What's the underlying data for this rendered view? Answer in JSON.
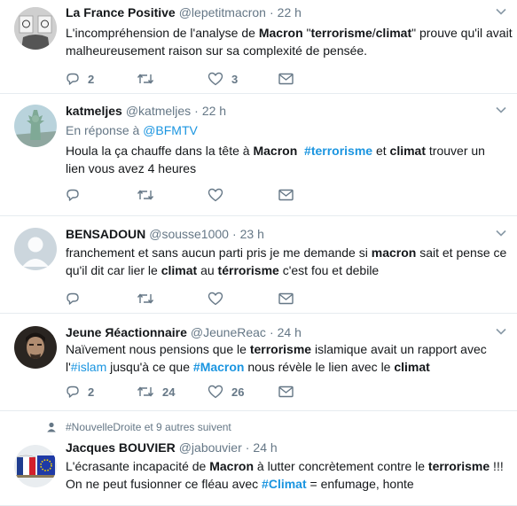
{
  "tweets": [
    {
      "name": "La France Positive",
      "handle": "@lepetitmacron",
      "time": "22 h",
      "text_lines": [
        [
          {
            "t": "L'incompréhension de l'analyse de "
          },
          {
            "t": "Macron",
            "s": "b"
          },
          {
            "t": " \""
          },
          {
            "t": "terrorisme",
            "s": "b"
          },
          {
            "t": "/"
          },
          {
            "t": "climat",
            "s": "b"
          },
          {
            "t": "\" prouve qu'il avait"
          }
        ],
        [
          {
            "t": "malheureusement raison sur sa complexité de pensée."
          }
        ]
      ],
      "replies": "2",
      "retweets": "",
      "likes": "3"
    },
    {
      "name": "katmeljes",
      "handle": "@katmeljes",
      "time": "22 h",
      "reply_prefix": "En réponse à",
      "reply_link": "@BFMTV",
      "text_lines": [
        [
          {
            "t": "Houla la ça chauffe dans la tête à "
          },
          {
            "t": "Macron",
            "s": "b"
          },
          {
            "t": "  "
          },
          {
            "t": "#terrorisme",
            "s": "tagb"
          },
          {
            "t": " et "
          },
          {
            "t": "climat",
            "s": "b"
          },
          {
            "t": " trouver un"
          }
        ],
        [
          {
            "t": "lien vous avez 4 heures"
          }
        ]
      ],
      "replies": "",
      "retweets": "",
      "likes": ""
    },
    {
      "name": "BENSADOUN",
      "handle": "@sousse1000",
      "time": "23 h",
      "text_lines": [
        [
          {
            "t": "franchement et sans aucun parti pris je me demande si "
          },
          {
            "t": "macron",
            "s": "b"
          },
          {
            "t": " sait et pense ce"
          }
        ],
        [
          {
            "t": "qu'il dit car lier le "
          },
          {
            "t": "climat",
            "s": "b"
          },
          {
            "t": " au "
          },
          {
            "t": "térrorisme",
            "s": "b"
          },
          {
            "t": " c'est fou et debile"
          }
        ]
      ],
      "replies": "",
      "retweets": "",
      "likes": ""
    },
    {
      "name": "Jeune Яéactionnaire",
      "handle": "@JeuneReac",
      "time": "24 h",
      "text_lines": [
        [
          {
            "t": "Naïvement nous pensions que le "
          },
          {
            "t": "terrorisme",
            "s": "b"
          },
          {
            "t": " islamique avait un rapport avec"
          }
        ],
        [
          {
            "t": "l'"
          },
          {
            "t": "#islam",
            "s": "tag"
          },
          {
            "t": " jusqu'à ce que "
          },
          {
            "t": "#Macron",
            "s": "tagb"
          },
          {
            "t": " nous révèle le lien avec le "
          },
          {
            "t": "climat",
            "s": "b"
          }
        ]
      ],
      "replies": "2",
      "retweets": "24",
      "likes": "26"
    },
    {
      "context": "#NouvelleDroite et 9 autres suivent",
      "name": "Jacques BOUVIER",
      "handle": "@jabouvier",
      "time": "24 h",
      "text_lines": [
        [
          {
            "t": "L'écrasante incapacité de "
          },
          {
            "t": "Macron",
            "s": "b"
          },
          {
            "t": " à lutter concrètement contre le "
          },
          {
            "t": "terrorisme",
            "s": "b"
          },
          {
            "t": " !!!"
          }
        ],
        [
          {
            "t": "On ne peut fusionner ce fléau avec "
          },
          {
            "t": "#Climat",
            "s": "tagb"
          },
          {
            "t": " = enfumage, honte"
          }
        ]
      ]
    }
  ],
  "icons": {
    "reply": "reply-icon",
    "retweet": "retweet-icon",
    "like": "heart-icon",
    "dm": "envelope-icon",
    "more": "chevron-down-icon",
    "context": "person-icon"
  },
  "colors": {
    "text": "#14171a",
    "secondary": "#657786",
    "link": "#1b95e0",
    "border": "#e6ecf0"
  }
}
